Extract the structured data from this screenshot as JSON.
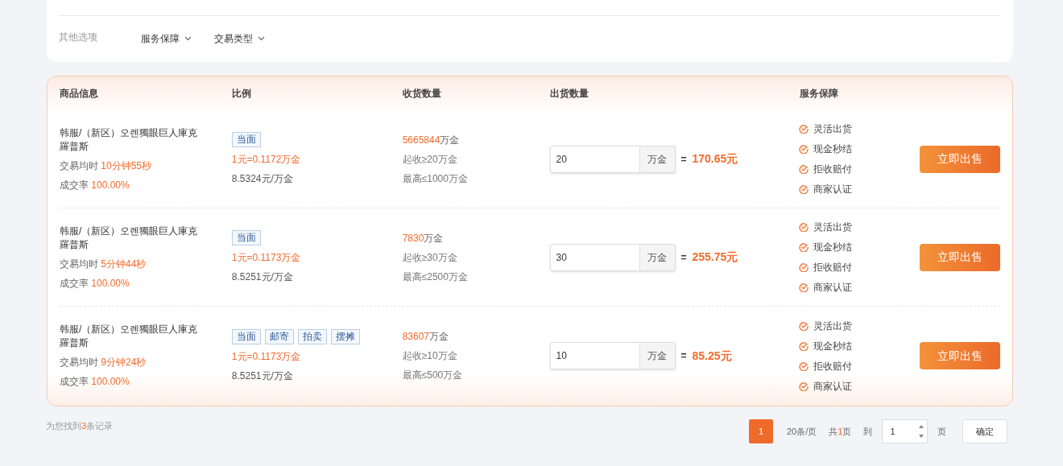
{
  "filters": {
    "label": "其他选项",
    "dropdowns": [
      "服务保障",
      "交易类型"
    ]
  },
  "table": {
    "columns": [
      "商品信息",
      "比例",
      "收货数量",
      "出货数量",
      "服务保障"
    ],
    "rows": [
      {
        "name": "韩服/（新区）오렌獨眼巨人庫克羅普斯",
        "avg_time_label": "交易均时",
        "avg_time": "10分钟55秒",
        "rate_label": "成交率",
        "rate": "100.00%",
        "tags": [
          "当面"
        ],
        "ratio": "1元=0.1172万金",
        "unit_price": "8.5324元/万金",
        "stock": "5665844",
        "stock_unit": "万金",
        "min": "起收≥20万金",
        "max": "最高≤1000万金",
        "quantity": "20",
        "quantity_unit": "万金",
        "equals": "=",
        "total": "170.65元",
        "services": [
          "灵活出货",
          "现金秒结",
          "拒收赔付",
          "商家认证"
        ],
        "button": "立即出售"
      },
      {
        "name": "韩服/（新区）오렌獨眼巨人庫克羅普斯",
        "avg_time_label": "交易均时",
        "avg_time": "5分钟44秒",
        "rate_label": "成交率",
        "rate": "100.00%",
        "tags": [
          "当面"
        ],
        "ratio": "1元=0.1173万金",
        "unit_price": "8.5251元/万金",
        "stock": "7830",
        "stock_unit": "万金",
        "min": "起收≥30万金",
        "max": "最高≤2500万金",
        "quantity": "30",
        "quantity_unit": "万金",
        "equals": "=",
        "total": "255.75元",
        "services": [
          "灵活出货",
          "现金秒结",
          "拒收赔付",
          "商家认证"
        ],
        "button": "立即出售"
      },
      {
        "name": "韩服/（新区）오렌獨眼巨人庫克羅普斯",
        "avg_time_label": "交易均时",
        "avg_time": "9分钟24秒",
        "rate_label": "成交率",
        "rate": "100.00%",
        "tags": [
          "当面",
          "邮寄",
          "拍卖",
          "摆摊"
        ],
        "ratio": "1元=0.1173万金",
        "unit_price": "8.5251元/万金",
        "stock": "83607",
        "stock_unit": "万金",
        "min": "起收≥10万金",
        "max": "最高≤500万金",
        "quantity": "10",
        "quantity_unit": "万金",
        "equals": "=",
        "total": "85.25元",
        "services": [
          "灵活出货",
          "现金秒结",
          "拒收赔付",
          "商家认证"
        ],
        "button": "立即出售"
      }
    ]
  },
  "footer": {
    "found_prefix": "为您找到",
    "found_count": "3",
    "found_suffix": "条记录"
  },
  "pagination": {
    "pages": [
      {
        "label": "1",
        "selected": true
      }
    ],
    "page_size": "20条/页",
    "total_prefix": "共",
    "total_count": "1",
    "total_suffix": "页",
    "goto_label": "到",
    "goto_value": "1",
    "goto_suffix": "页",
    "confirm": "确定"
  }
}
